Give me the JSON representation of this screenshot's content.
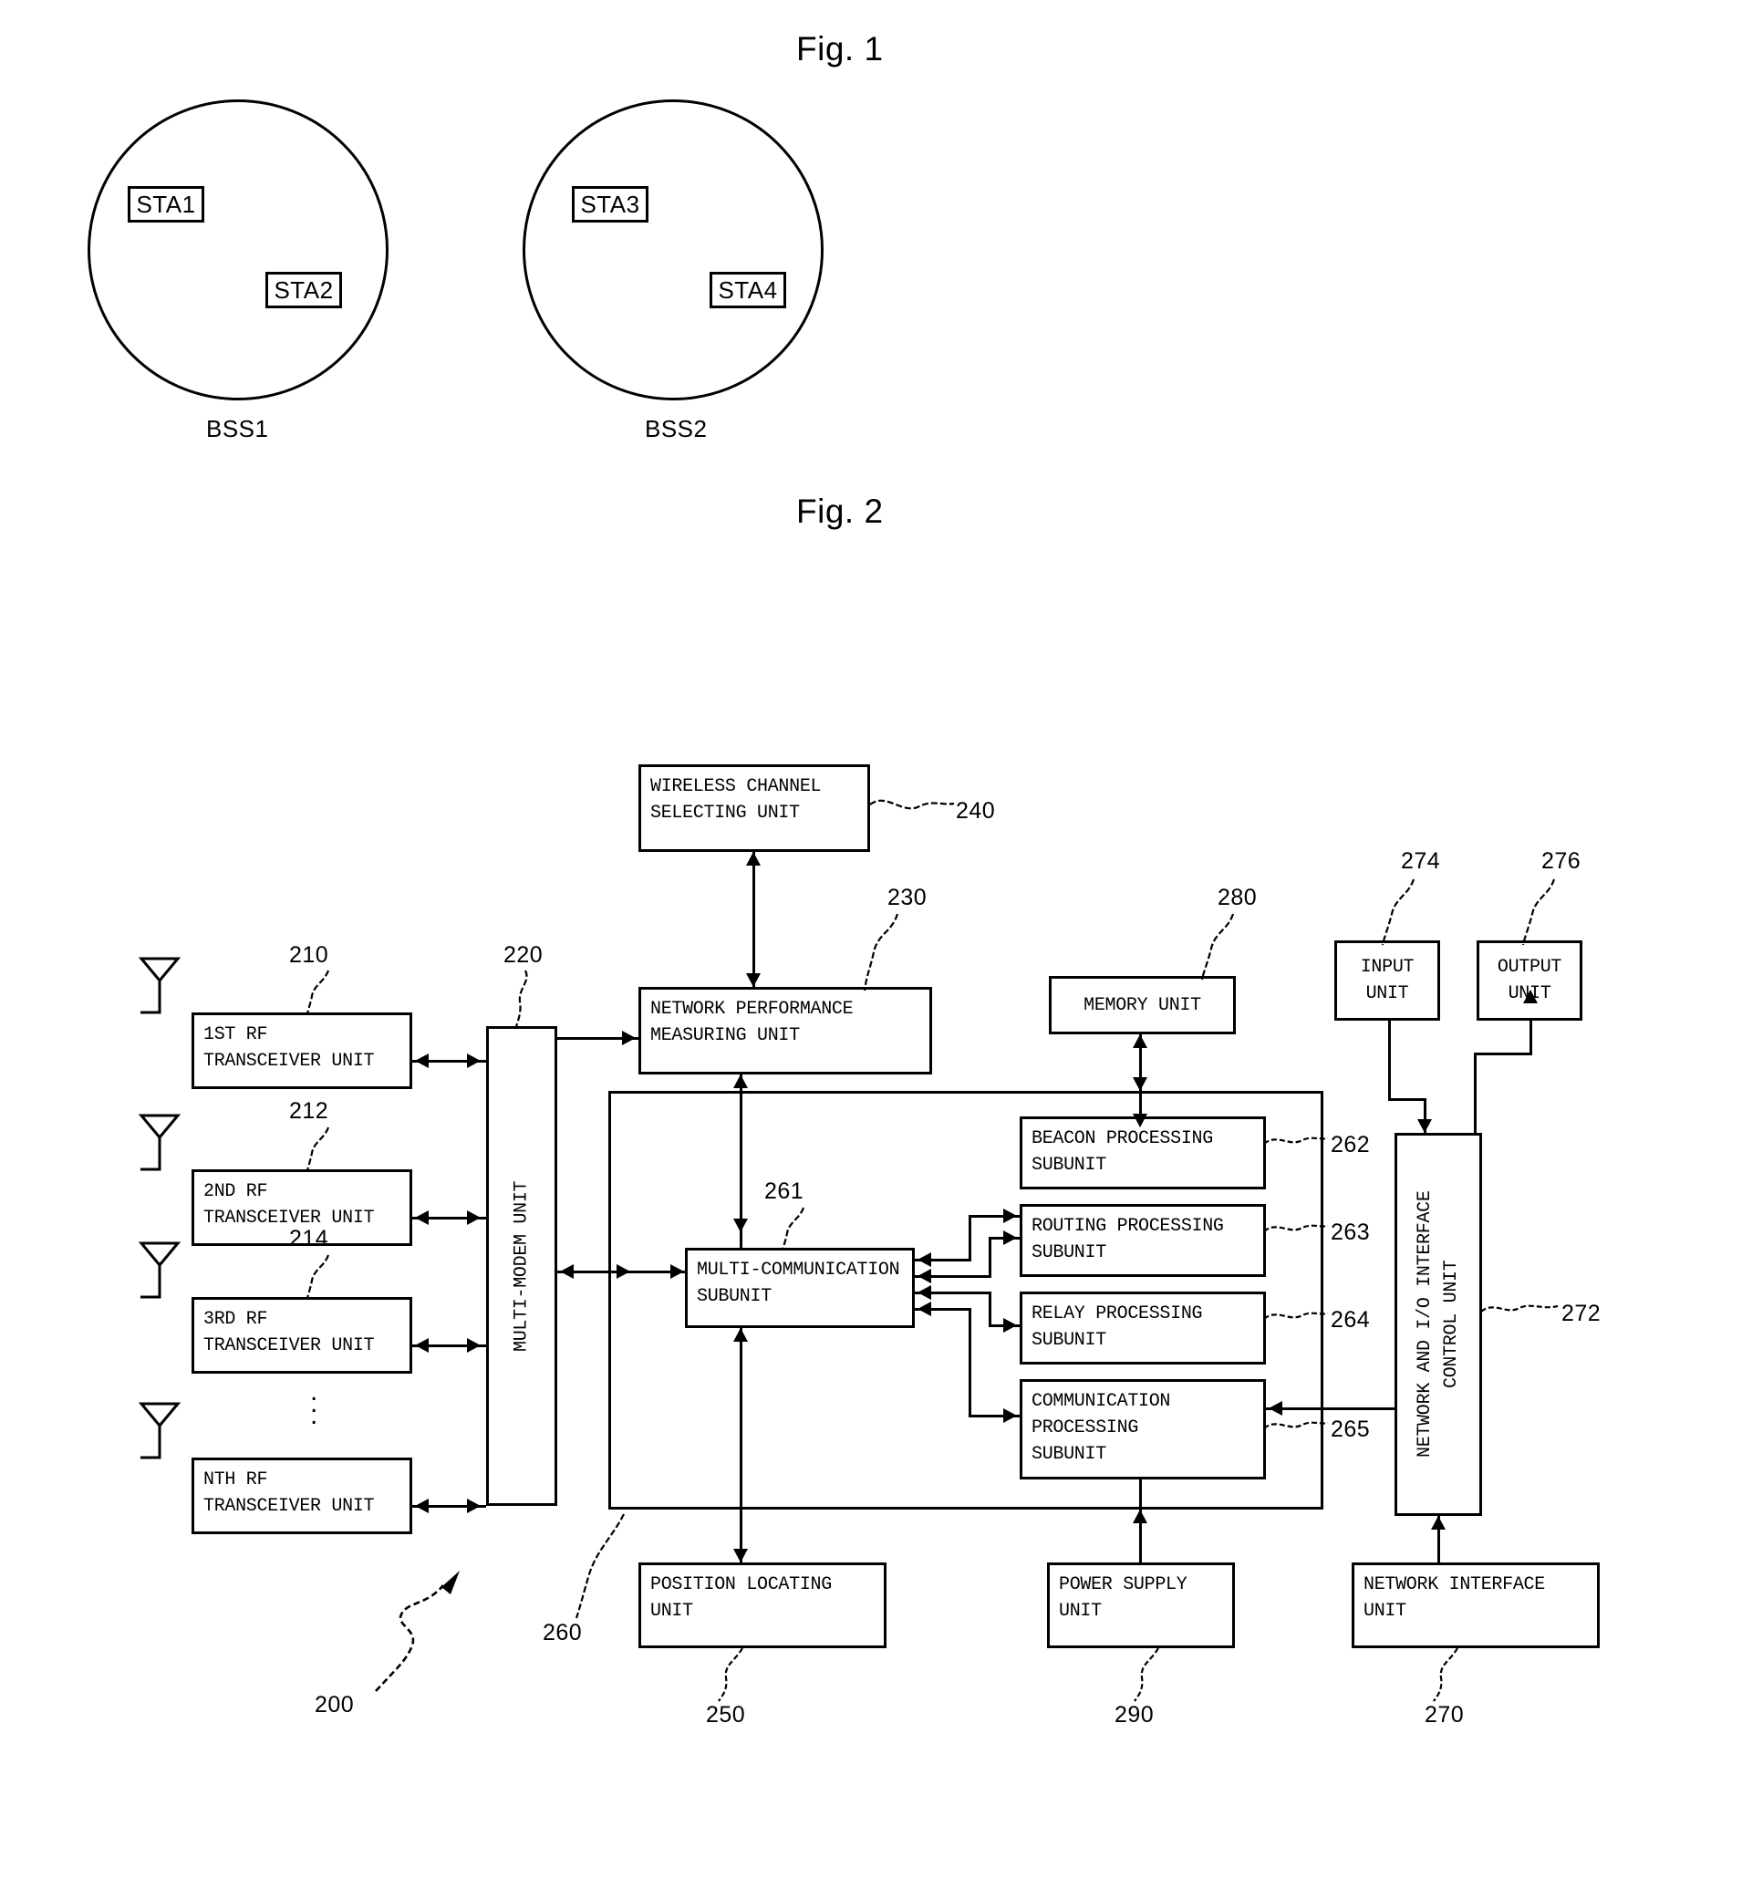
{
  "figures": [
    {
      "id": "fig1",
      "title": "Fig. 1"
    },
    {
      "id": "fig2",
      "title": "Fig. 2"
    }
  ],
  "fig1": {
    "title": "Fig. 1",
    "cells": [
      {
        "label": "BSS1",
        "stations": [
          "STA1",
          "STA2"
        ]
      },
      {
        "label": "BSS2",
        "stations": [
          "STA3",
          "STA4"
        ]
      }
    ],
    "sta1": "STA1",
    "sta2": "STA2",
    "sta3": "STA3",
    "sta4": "STA4",
    "bss1": "BSS1",
    "bss2": "BSS2"
  },
  "fig2": {
    "title": "Fig. 2",
    "blocks": {
      "wireless_channel_selecting_unit": "WIRELESS CHANNEL\nSELECTING UNIT",
      "network_performance_measuring_unit": "NETWORK PERFORMANCE\nMEASURING UNIT",
      "memory_unit": "MEMORY UNIT",
      "input_unit": "INPUT\nUNIT",
      "output_unit": "OUTPUT\nUNIT",
      "rf1": "1ST RF\nTRANSCEIVER UNIT",
      "rf2": "2ND RF\nTRANSCEIVER UNIT",
      "rf3": "3RD RF\nTRANSCEIVER UNIT",
      "rfn": "NTH RF\nTRANSCEIVER UNIT",
      "multi_modem_unit": "MULTI-MODEM UNIT",
      "multi_communication_subunit": "MULTI-COMMUNICATION\nSUBUNIT",
      "beacon_processing_subunit": "BEACON PROCESSING\nSUBUNIT",
      "routing_processing_subunit": "ROUTING PROCESSING\nSUBUNIT",
      "relay_processing_subunit": "RELAY PROCESSING\nSUBUNIT",
      "communication_processing_subunit": "COMMUNICATION\nPROCESSING\nSUBUNIT",
      "network_io_interface_control_unit": "NETWORK AND I/O INTERFACE\nCONTROL UNIT",
      "position_locating_unit": "POSITION LOCATING\nUNIT",
      "power_supply_unit": "POWER SUPPLY\nUNIT",
      "network_interface_unit": "NETWORK INTERFACE\nUNIT"
    },
    "refs": {
      "r200": "200",
      "r210": "210",
      "r212": "212",
      "r214": "214",
      "r220": "220",
      "r230": "230",
      "r240": "240",
      "r250": "250",
      "r260": "260",
      "r261": "261",
      "r262": "262",
      "r263": "263",
      "r264": "264",
      "r265": "265",
      "r270": "270",
      "r272": "272",
      "r274": "274",
      "r276": "276",
      "r280": "280",
      "r290": "290"
    }
  }
}
